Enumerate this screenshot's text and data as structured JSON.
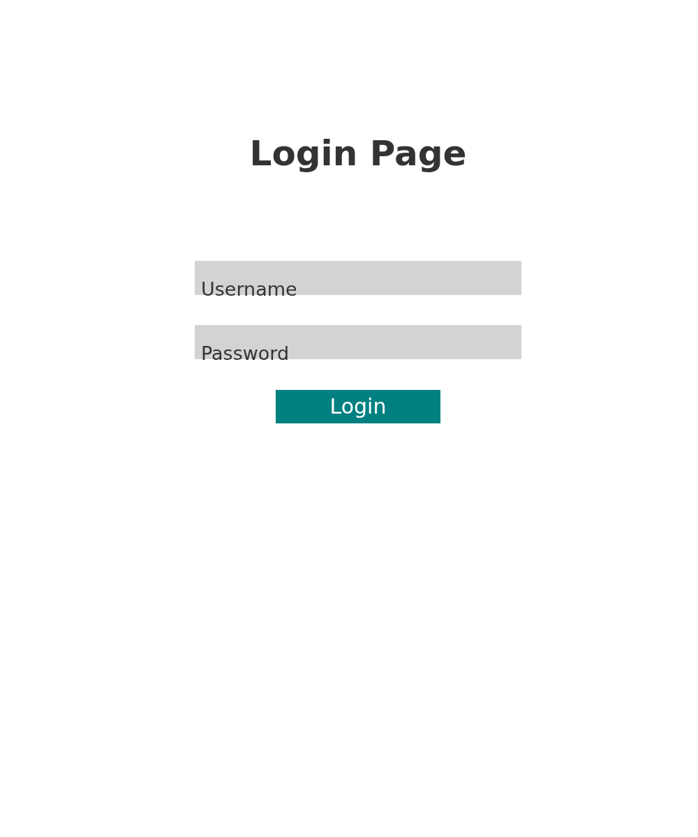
{
  "title": "Login Page",
  "fields": [
    {
      "placeholder": "Username"
    },
    {
      "placeholder": "Password"
    }
  ],
  "button": {
    "label": "Login"
  }
}
